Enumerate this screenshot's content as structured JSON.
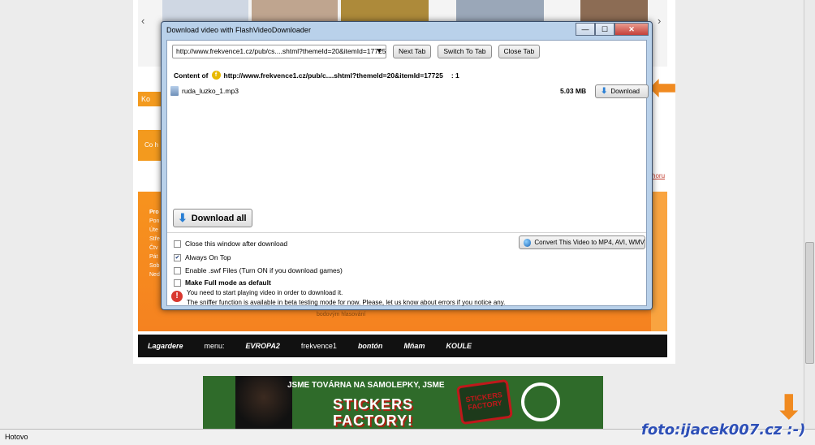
{
  "dialog": {
    "title": "Download video with FlashVideoDownloader",
    "controls": {
      "minimize": "—",
      "maximize": "☐",
      "close": "✕"
    },
    "url_select": "http://www.frekvence1.cz/pub/cs....shtml?themeId=20&itemId=17725",
    "buttons": {
      "next_tab": "Next Tab",
      "switch_to_tab": "Switch To Tab",
      "close_tab": "Close Tab"
    },
    "content_of": {
      "label": "Content of",
      "url": "http://www.frekvence1.cz/pub/c....shtml?themeId=20&itemId=17725",
      "count": ": 1"
    },
    "file": {
      "name": "ruda_luzko_1.mp3",
      "size": "5.03 MB",
      "download_label": "Download"
    },
    "download_all_label": "Download all",
    "convert_label": "Convert This Video to MP4, AVI, WMV",
    "options": [
      {
        "label": "Close this window after download",
        "checked": false,
        "bold": false
      },
      {
        "label": "Always On Top",
        "checked": true,
        "bold": false
      },
      {
        "label": "Enable .swf Files (Turn ON if you download games)",
        "checked": false,
        "bold": false
      },
      {
        "label": "Make Full mode as default",
        "checked": false,
        "bold": true
      }
    ],
    "warning_line1": "You need to start playing video in order to download it.",
    "warning_line2": "The sniffer function is available in beta testing mode for now. Please, let us know about errors if you notice any."
  },
  "background": {
    "orange_label": "Ko",
    "orange_box_label": "Co h",
    "side_links": [
      "Pro",
      "Pon",
      "Úte",
      "Stře",
      "Čtv",
      "Pát",
      "Sob",
      "Ned"
    ],
    "right_link": "horu",
    "caption": "bodovým hlasování",
    "footer_brands": [
      "Lagardere",
      "menu:",
      "EVROPA2",
      "frekvence1",
      "bontón",
      "Mňam",
      "KOULE"
    ],
    "banner_line1": "JSME TOVÁRNA NA SAMOLEPKY, JSME",
    "banner_line2": "STICKERS",
    "banner_line3": "FACTORY!",
    "banner_sticker": "STICKERS FACTORY"
  },
  "statusbar": {
    "text": "Hotovo"
  },
  "watermark": "foto:ijacek007.cz :-)",
  "colors": {
    "accent_orange": "#f08a20",
    "watermark_blue": "#2d4fb7",
    "dialog_frame": "#b9d1ea"
  },
  "icons": [
    "fvd-icon",
    "audio-file-icon",
    "download-arrow-icon",
    "convert-icon",
    "warning-icon",
    "orange-arrow-icon"
  ]
}
